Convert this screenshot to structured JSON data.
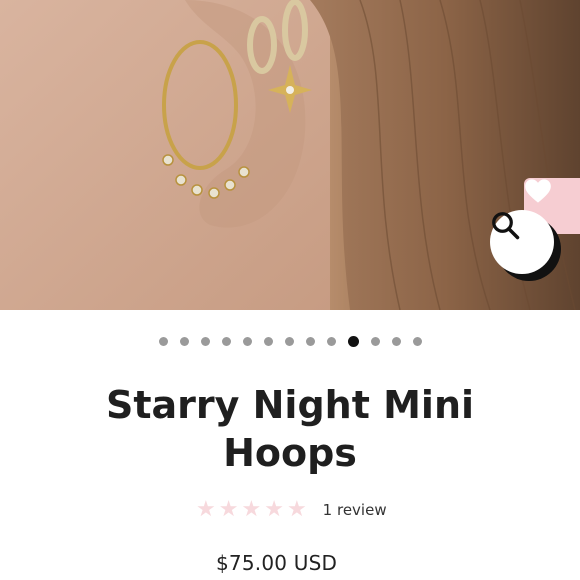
{
  "product": {
    "image_alt": "Starry Night Mini Hoops worn on ear",
    "title": "Starry Night Mini Hoops",
    "review_count_text": "1 review",
    "rating_stars": 5,
    "rating_filled": 0,
    "price": "$75.00 USD"
  },
  "gallery": {
    "dot_count": 13,
    "active_index": 9
  },
  "icons": {
    "wishlist": "heart-icon",
    "zoom": "magnifier-icon",
    "star": "star-icon"
  },
  "colors": {
    "wishlist_bg": "#f6cdd2",
    "star_empty": "#f7d9dd",
    "dot_inactive": "#9a9a9a",
    "dot_active": "#111111",
    "text": "#1f1f1f"
  }
}
